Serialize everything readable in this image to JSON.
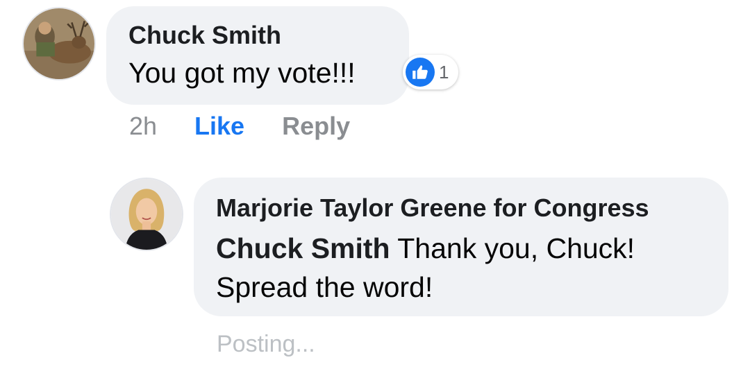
{
  "comment": {
    "author": "Chuck Smith",
    "text": "You got my vote!!!",
    "avatar_icon": "hunter-with-deer-avatar",
    "reaction": {
      "icon": "thumbs-up-icon",
      "count": "1",
      "color": "#1877f2"
    },
    "actions": {
      "time": "2h",
      "like_label": "Like",
      "reply_label": "Reply"
    }
  },
  "reply": {
    "author": "Marjorie Taylor Greene for Congress",
    "mention": "Chuck Smith",
    "text_line1": " Thank you, Chuck!",
    "text_line2": "Spread the word!",
    "avatar_icon": "woman-portrait-avatar",
    "status": "Posting..."
  },
  "colors": {
    "bubble_bg": "#f0f2f5",
    "link_blue": "#1877f2",
    "secondary_text": "#8a8d91",
    "primary_text": "#050505"
  }
}
